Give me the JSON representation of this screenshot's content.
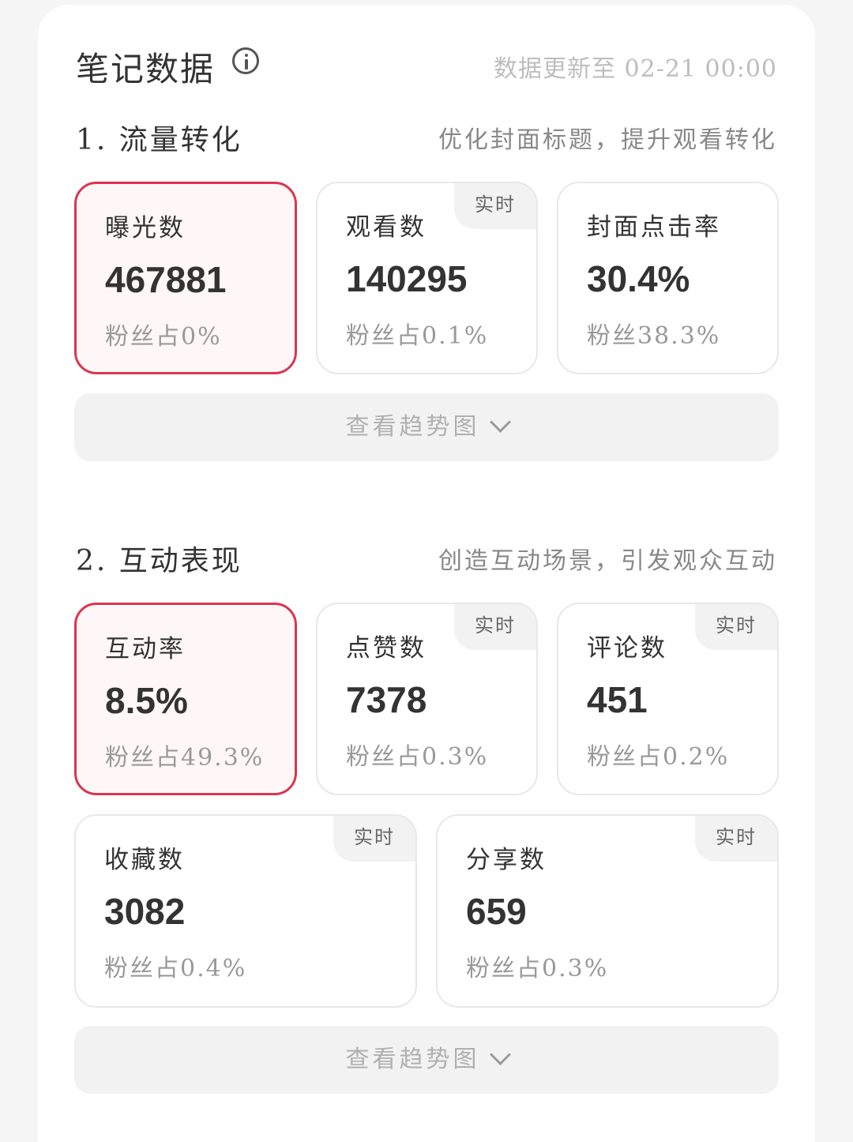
{
  "header": {
    "title": "笔记数据",
    "update_text": "数据更新至 02-21 00:00"
  },
  "sections": [
    {
      "title": "1. 流量转化",
      "hint": "优化封面标题，提升观看转化",
      "metrics": [
        {
          "label": "曝光数",
          "value": "467881",
          "sub": "粉丝占0%",
          "active": true
        },
        {
          "label": "观看数",
          "value": "140295",
          "sub": "粉丝占0.1%",
          "badge": "实时"
        },
        {
          "label": "封面点击率",
          "value": "30.4%",
          "sub": "粉丝38.3%"
        }
      ],
      "trend_label": "查看趋势图"
    },
    {
      "title": "2. 互动表现",
      "hint": "创造互动场景，引发观众互动",
      "metrics": [
        {
          "label": "互动率",
          "value": "8.5%",
          "sub": "粉丝占49.3%",
          "active": true
        },
        {
          "label": "点赞数",
          "value": "7378",
          "sub": "粉丝占0.3%",
          "badge": "实时"
        },
        {
          "label": "评论数",
          "value": "451",
          "sub": "粉丝占0.2%",
          "badge": "实时"
        },
        {
          "label": "收藏数",
          "value": "3082",
          "sub": "粉丝占0.4%",
          "badge": "实时"
        },
        {
          "label": "分享数",
          "value": "659",
          "sub": "粉丝占0.3%",
          "badge": "实时"
        }
      ],
      "trend_label": "查看趋势图"
    }
  ],
  "colors": {
    "accent": "#d9364f",
    "active_bg": "#fff7f7"
  }
}
